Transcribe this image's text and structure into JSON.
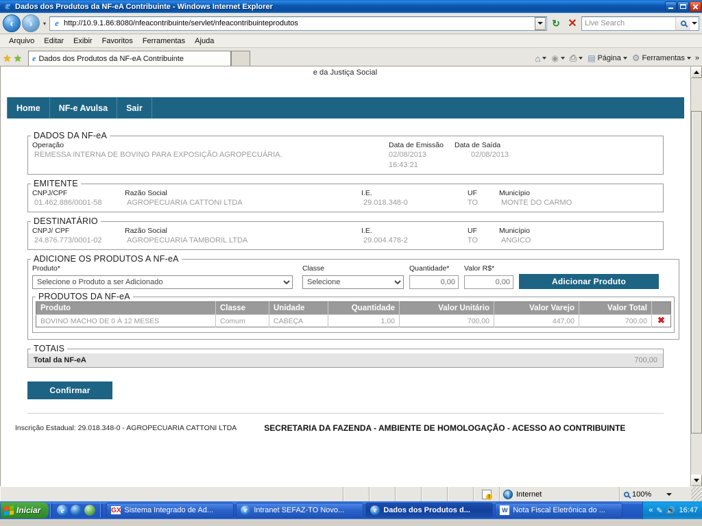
{
  "window": {
    "title": "Dados dos Produtos da NF-eA Contribuinte - Windows Internet Explorer",
    "minimize_label": "Minimizar",
    "maximize_label": "Restaurar",
    "close_label": "Fechar"
  },
  "browser": {
    "back_label": "Voltar",
    "forward_label": "Avançar",
    "url": "http://10.9.1.86:8080/nfeacontribuinte/servlet/nfeacontribuinteprodutos",
    "refresh_label": "Atualizar",
    "stop_label": "Parar",
    "search_placeholder": "Live Search",
    "menu": [
      "Arquivo",
      "Editar",
      "Exibir",
      "Favoritos",
      "Ferramentas",
      "Ajuda"
    ],
    "tab_title": "Dados dos Produtos da NF-eA Contribuinte",
    "commands": {
      "home": "",
      "feeds": "",
      "print": "",
      "page": "Página",
      "tools": "Ferramentas",
      "overflow": "»"
    }
  },
  "page": {
    "top_slogan": "e da Justiça Social",
    "nav": [
      "Home",
      "NF-e Avulsa",
      "Sair"
    ],
    "nfea": {
      "legend": "DADOS DA NF-eA",
      "labels": {
        "operacao": "Operação",
        "data_emissao": "Data de Emissão",
        "data_saida": "Data de Saída"
      },
      "values": {
        "operacao": "REMESSA INTERNA DE BOVINO PARA EXPOSIÇÃO AGROPECUÁRIA.",
        "data_emissao": "02/08/2013 16:43:21",
        "data_saida": "02/08/2013"
      }
    },
    "emitente": {
      "legend": "EMITENTE",
      "labels": {
        "cnpj": "CNPJ/CPF",
        "razao": "Razão Social",
        "ie": "I.E.",
        "uf": "UF",
        "municipio": "Município"
      },
      "values": {
        "cnpj": "01.462.886/0001-58",
        "razao": "AGROPECUARIA CATTONI LTDA",
        "ie": "29.018.348-0",
        "uf": "TO",
        "municipio": "MONTE DO CARMO"
      }
    },
    "destinatario": {
      "legend": "DESTINATÁRIO",
      "labels": {
        "cnpj": "CNPJ/ CPF",
        "razao": "Razão Social",
        "ie": "I.E.",
        "uf": "UF",
        "municipio": "Município"
      },
      "values": {
        "cnpj": "24.876.773/0001-02",
        "razao": "AGROPECUARIA TAMBORIL LTDA",
        "ie": "29.004.478-2",
        "uf": "TO",
        "municipio": "ANGICO"
      }
    },
    "adicione": {
      "legend": "ADICIONE OS PRODUTOS A NF-eA",
      "labels": {
        "produto": "Produto*",
        "classe": "Classe",
        "quantidade": "Quantidade*",
        "valor": "Valor R$*"
      },
      "produto_selected": "Selecione o Produto a ser Adicionado",
      "classe_selected": "Selecione",
      "quantidade_value": "0,00",
      "valor_value": "0,00",
      "add_button": "Adicionar Produto"
    },
    "produtos": {
      "legend": "PRODUTOS DA NF-eA",
      "columns": [
        "Produto",
        "Classe",
        "Unidade",
        "Quantidade",
        "Valor Unitário",
        "Valor Varejo",
        "Valor Total",
        ""
      ],
      "rows": [
        {
          "produto": "BOVINO MACHO DE 0 À 12 MESES",
          "classe": "Comum",
          "unidade": "CABEÇA",
          "quantidade": "1,00",
          "valor_unitario": "700,00",
          "valor_varejo": "447,00",
          "valor_total": "700,00",
          "delete": "✖"
        }
      ]
    },
    "totais": {
      "legend": "TOTAIS",
      "label": "Total da NF-eA",
      "value": "700,00"
    },
    "confirm_button": "Confirmar",
    "footer": {
      "left": "Inscrição Estadual: 29.018.348-0 - AGROPECUARIA CATTONI LTDA",
      "right": "SECRETARIA DA FAZENDA - AMBIENTE DE HOMOLOGAÇÃO - ACESSO AO CONTRIBUINTE"
    }
  },
  "statusbar": {
    "zone": "Internet",
    "zoom": "100%"
  },
  "taskbar": {
    "start": "Iniciar",
    "items": [
      {
        "label": "Sistema Integrado de Ad...",
        "icon": "gx-icon",
        "active": false
      },
      {
        "label": "Intranet SEFAZ-TO Novo...",
        "icon": "ie-icon",
        "active": false
      },
      {
        "label": "Dados dos Produtos d...",
        "icon": "ie-icon",
        "active": true
      },
      {
        "label": "Nota Fiscal Eletrônica do ...",
        "icon": "word-icon",
        "active": false
      }
    ],
    "clock": "16:47",
    "tray_chevron": "«"
  },
  "colors": {
    "accent_teal": "#1d6384",
    "table_header_gray": "#9a9a9a",
    "total_row_bg": "#e4e4e4",
    "delete_red": "#cc2222"
  }
}
